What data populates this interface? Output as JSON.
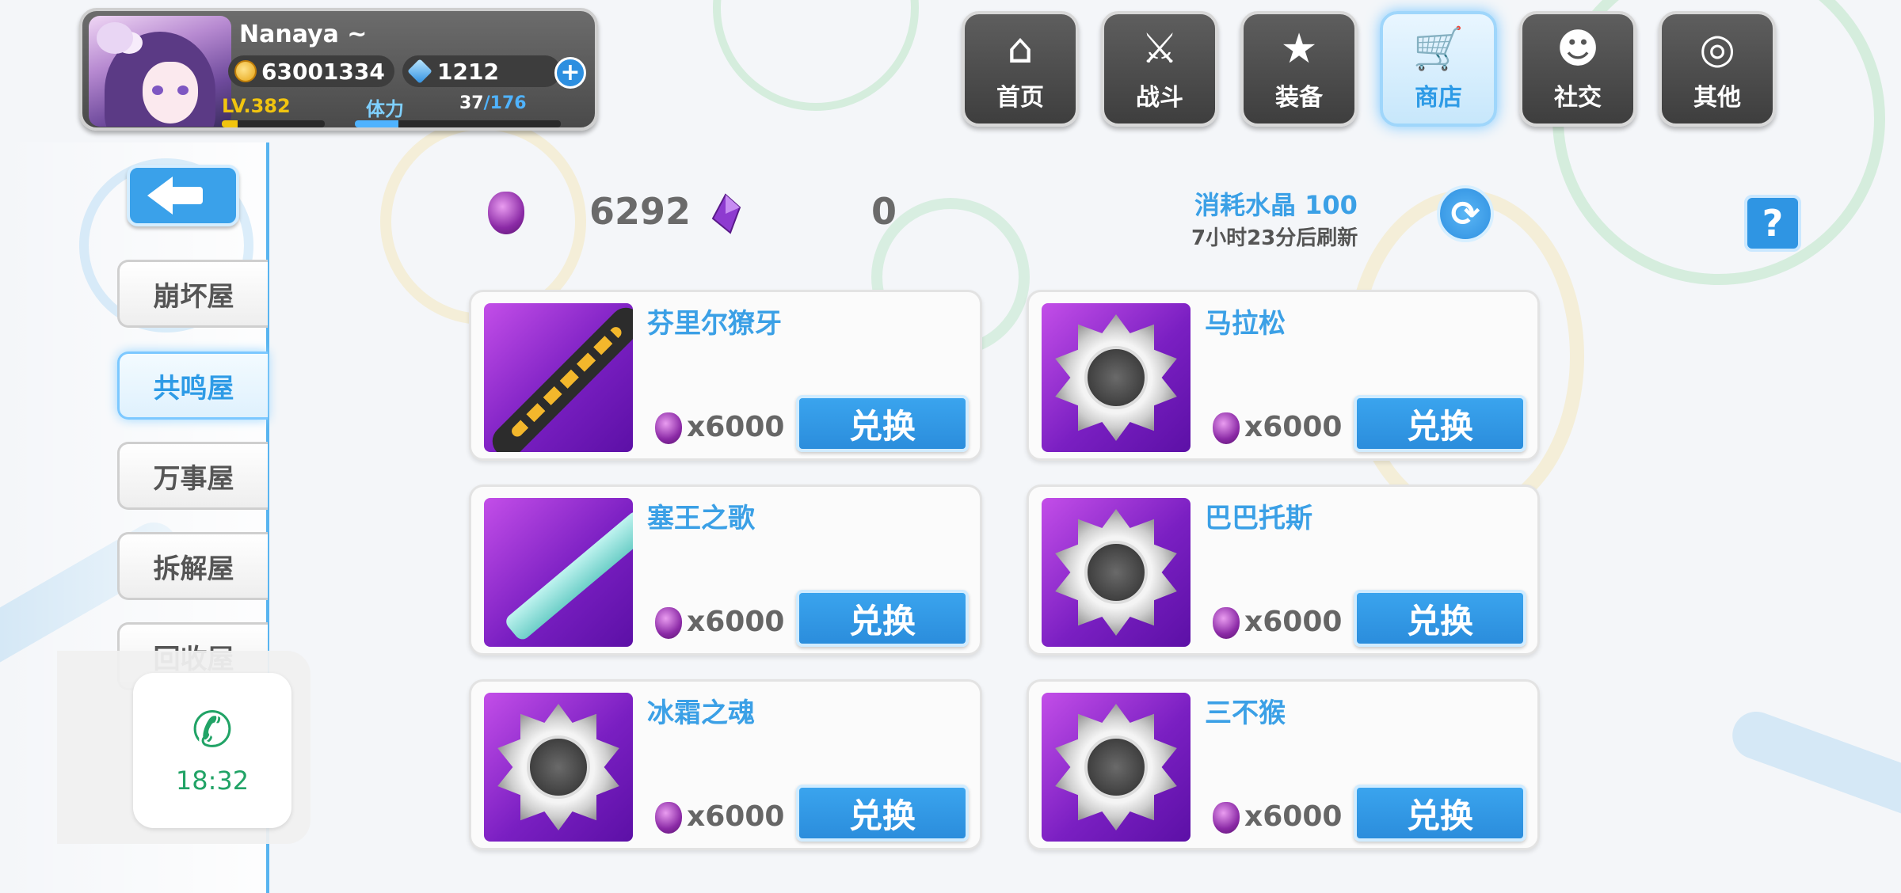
{
  "player": {
    "name": "Nanaya ~",
    "gold": "63001334",
    "gems": "1212",
    "level": "LV.382",
    "level_progress": 0.15,
    "stamina_label": "体力",
    "stamina_current": "37",
    "stamina_max": "/176",
    "stamina_progress": 0.21
  },
  "nav": [
    {
      "label": "首页",
      "icon": "home-icon",
      "active": false
    },
    {
      "label": "战斗",
      "icon": "battle-icon",
      "active": false
    },
    {
      "label": "装备",
      "icon": "equipment-icon",
      "active": false
    },
    {
      "label": "商店",
      "icon": "shop-icon",
      "active": true
    },
    {
      "label": "社交",
      "icon": "social-icon",
      "active": false
    },
    {
      "label": "其他",
      "icon": "other-icon",
      "active": false
    }
  ],
  "sidebar": {
    "tabs": [
      {
        "label": "崩坏屋",
        "active": false
      },
      {
        "label": "共鸣屋",
        "active": true
      },
      {
        "label": "万事屋",
        "active": false
      },
      {
        "label": "拆解屋",
        "active": false
      },
      {
        "label": "回收屋",
        "active": false
      }
    ]
  },
  "phone_widget": {
    "time": "18:32"
  },
  "shop": {
    "crystal_count": "6292",
    "shard_count": "0",
    "consume_text": "消耗水晶 100",
    "refresh_text": "7小时23分后刷新",
    "help_label": "?",
    "items": [
      {
        "name": "芬里尔獠牙",
        "price": "x6000",
        "button": "兑换",
        "thumb": "chainsaw-weapon"
      },
      {
        "name": "马拉松",
        "price": "x6000",
        "button": "兑换",
        "thumb": "medal-badge"
      },
      {
        "name": "塞王之歌",
        "price": "x6000",
        "button": "兑换",
        "thumb": "rifle-weapon"
      },
      {
        "name": "巴巴托斯",
        "price": "x6000",
        "button": "兑换",
        "thumb": "medal-badge"
      },
      {
        "name": "冰霜之魂",
        "price": "x6000",
        "button": "兑换",
        "thumb": "medal-badge"
      },
      {
        "name": "三不猴",
        "price": "x6000",
        "button": "兑换",
        "thumb": "medal-badge"
      }
    ]
  },
  "colors": {
    "accent_blue": "#3ba0e6",
    "crystal_purple": "#8b2aa6",
    "level_yellow": "#f1c40f",
    "phone_green": "#21a366"
  }
}
